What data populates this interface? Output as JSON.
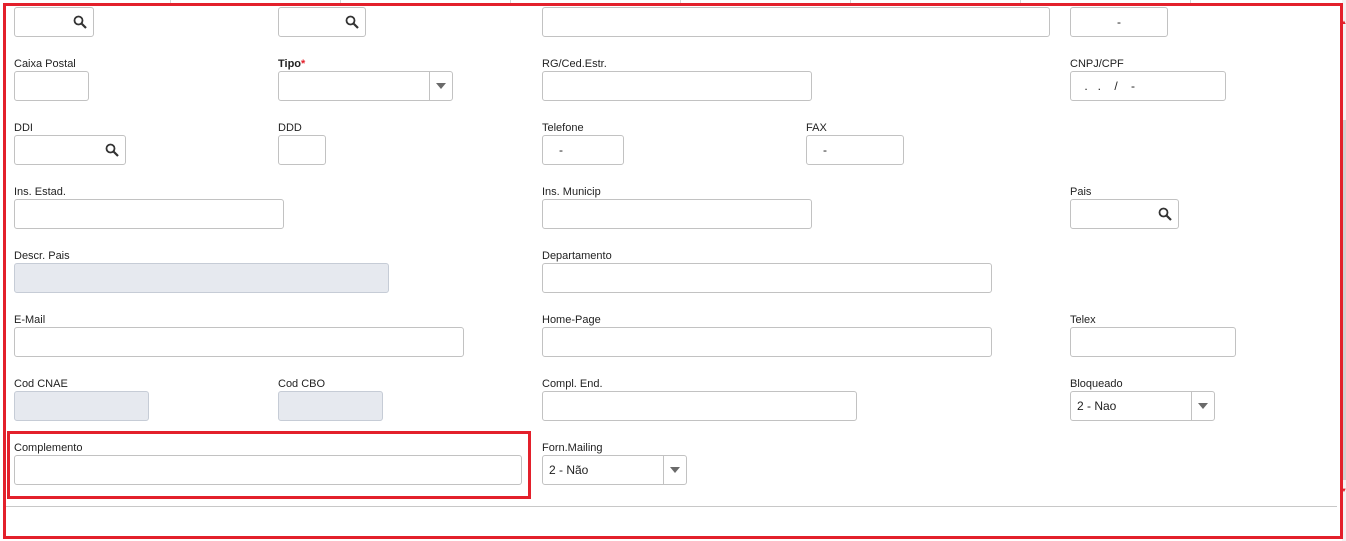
{
  "top_row": {
    "field4_value": "-"
  },
  "caixa_postal": {
    "label": "Caixa Postal",
    "value": ""
  },
  "tipo": {
    "label": "Tipo",
    "required_mark": "*",
    "value": ""
  },
  "rg": {
    "label": "RG/Ced.Estr.",
    "value": ""
  },
  "cnpj": {
    "label": "CNPJ/CPF",
    "value": " .   .    /    -"
  },
  "ddi": {
    "label": "DDI",
    "value": ""
  },
  "ddd": {
    "label": "DDD",
    "value": ""
  },
  "telefone": {
    "label": "Telefone",
    "value": "-"
  },
  "fax": {
    "label": "FAX",
    "value": "-"
  },
  "ins_estad": {
    "label": "Ins. Estad.",
    "value": ""
  },
  "ins_municip": {
    "label": "Ins. Municip",
    "value": ""
  },
  "pais": {
    "label": "Pais",
    "value": ""
  },
  "descr_pais": {
    "label": "Descr. Pais",
    "value": ""
  },
  "departamento": {
    "label": "Departamento",
    "value": ""
  },
  "email": {
    "label": "E-Mail",
    "value": ""
  },
  "home_page": {
    "label": "Home-Page",
    "value": ""
  },
  "telex": {
    "label": "Telex",
    "value": ""
  },
  "cod_cnae": {
    "label": "Cod CNAE",
    "value": ""
  },
  "cod_cbo": {
    "label": "Cod CBO",
    "value": ""
  },
  "compl_end": {
    "label": "Compl. End.",
    "value": ""
  },
  "bloqueado": {
    "label": "Bloqueado",
    "value": "2 - Nao"
  },
  "complemento": {
    "label": "Complemento",
    "value": ""
  },
  "forn_mailing": {
    "label": "Forn.Mailing",
    "value": "2 - Não"
  },
  "icons": {
    "search": "search-icon",
    "dropdown": "chevron-down-icon"
  },
  "colors": {
    "highlight": "#e3202b",
    "disabled_bg": "#e6e9ef",
    "border": "#c2c2c2"
  }
}
